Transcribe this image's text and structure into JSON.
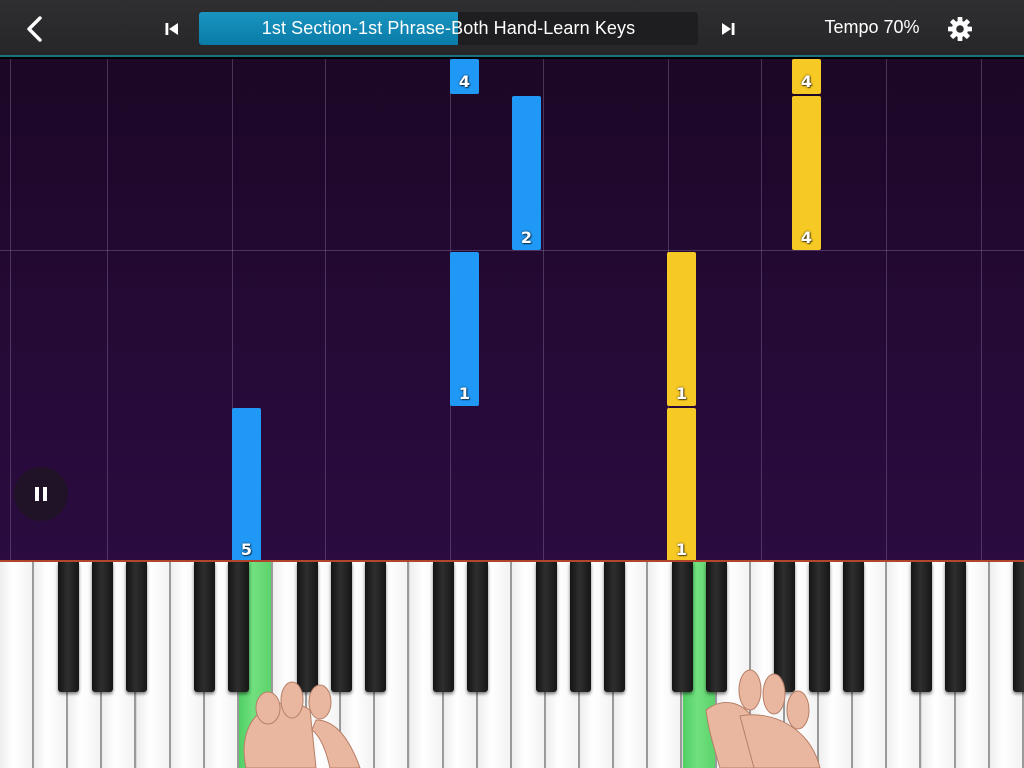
{
  "topbar": {
    "back_icon": "chevron-left-icon",
    "prev_icon": "skip-previous-icon",
    "next_icon": "skip-next-icon",
    "settings_icon": "gear-icon",
    "section_title": "1st Section-1st Phrase-Both Hand-Learn Keys",
    "progress": 0.52,
    "tempo_label": "Tempo 70%"
  },
  "colors": {
    "left_hand_note": "#2098f5",
    "right_hand_note": "#f7c925",
    "active_key": "#5bd36b",
    "progress": "#0a7ba8",
    "background": "#250a36"
  },
  "notes": [
    {
      "hand": "left",
      "finger": "4"
    },
    {
      "hand": "left",
      "finger": "2"
    },
    {
      "hand": "left",
      "finger": "1"
    },
    {
      "hand": "left",
      "finger": "5"
    },
    {
      "hand": "right",
      "finger": "4"
    },
    {
      "hand": "right",
      "finger": "4"
    },
    {
      "hand": "right",
      "finger": "1"
    },
    {
      "hand": "right",
      "finger": "1"
    }
  ],
  "player": {
    "pause_icon": "pause-icon"
  }
}
